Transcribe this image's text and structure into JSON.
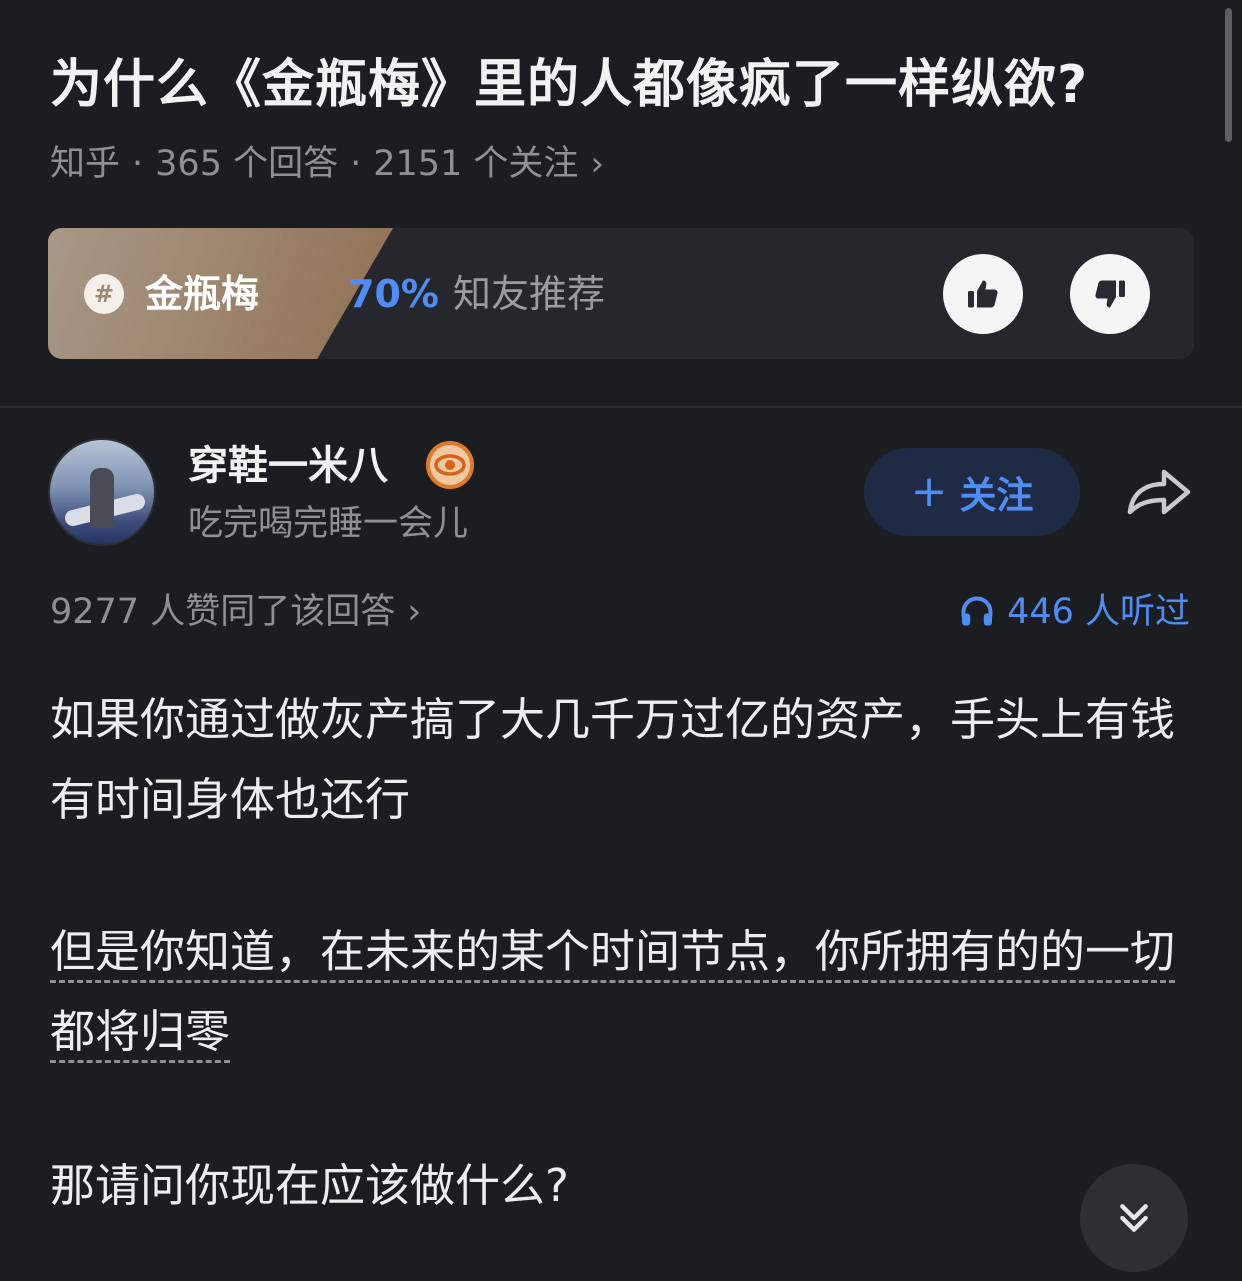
{
  "question": {
    "title": "为什么《金瓶梅》里的人都像疯了一样纵欲?",
    "source": "知乎",
    "answers_count": "365 个回答",
    "followers_count": "2151 个关注",
    "separator": "·"
  },
  "topic": {
    "name": "金瓶梅",
    "recommend_percent": "70%",
    "recommend_label": "知友推荐"
  },
  "author": {
    "name": "穿鞋一米八",
    "bio": "吃完喝完睡一会儿",
    "follow_label": "关注"
  },
  "stats": {
    "approvals": "9277 人赞同了该回答",
    "listens": "446 人听过"
  },
  "answer": {
    "paragraph1": "如果你通过做灰产搞了大几千万过亿的资产，手头上有钱有时间身体也还行",
    "paragraph2": "但是你知道，在未来的某个时间节点，你所拥有的的一切都将归零",
    "paragraph3": "那请问你现在应该做什么?"
  },
  "colors": {
    "background": "#1c1d20",
    "accent": "#4f8df5"
  }
}
